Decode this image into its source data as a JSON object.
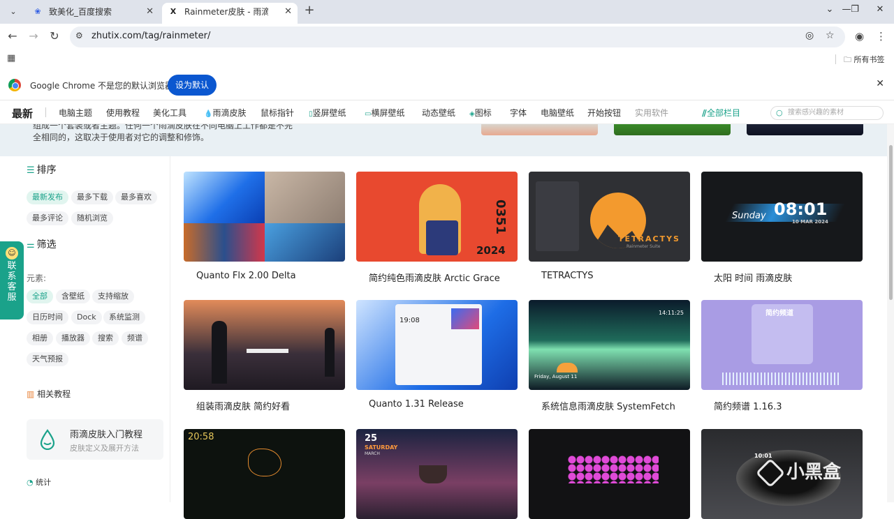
{
  "browser": {
    "tabs": [
      {
        "title": "致美化_百度搜索",
        "favicon": "baidu-paw-icon",
        "active": false
      },
      {
        "title": "Rainmeter皮肤 - 雨滴皮肤 - 致美化",
        "favicon": "zhutix-x-icon",
        "active": true
      }
    ],
    "url": "zhutix.com/tag/rainmeter/",
    "all_bookmarks": "所有书签"
  },
  "infobar": {
    "message": "Google Chrome 不是您的默认浏览器",
    "button": "设为默认"
  },
  "site_nav": {
    "latest": "最新",
    "items": [
      "电脑主题",
      "使用教程",
      "美化工具",
      "雨滴皮肤",
      "鼠标指针",
      "竖屏壁纸",
      "横屏壁纸",
      "动态壁纸",
      "图标",
      "字体",
      "电脑壁纸",
      "开始按钮",
      "实用软件"
    ],
    "all_columns": "全部栏目",
    "search_placeholder": "搜索感兴趣的素材"
  },
  "hero": {
    "text": "组成一个套装或者主题。任何一个雨滴皮肤在不同电脑上工作都是不完全相同的，这取决于使用者对它的调整和修饰。"
  },
  "sidebar": {
    "sort_title": "排序",
    "sort_options": [
      "最新发布",
      "最多下载",
      "最多喜欢",
      "最多评论",
      "随机浏览"
    ],
    "filter_title": "筛选",
    "elements_label": "元素:",
    "element_options": [
      "全部",
      "含壁纸",
      "支持缩放",
      "日历时间",
      "Dock",
      "系统监测",
      "相册",
      "播放器",
      "搜索",
      "频谱",
      "天气预报"
    ],
    "related_title": "相关教程",
    "tutorial_title": "雨滴皮肤入门教程",
    "tutorial_sub": "皮肤定义及展开方法",
    "stats_title": "统计"
  },
  "customer_service": "联系客服",
  "cards": [
    {
      "title": "Quanto Flx 2.00 Delta"
    },
    {
      "title": "简约纯色雨滴皮肤 Arctic Grace",
      "art_text": [
        "0351",
        "2024"
      ]
    },
    {
      "title": "TETRACTYS",
      "art_text": [
        "TETRACTYS",
        "Rainmeter Suite"
      ]
    },
    {
      "title": "太阳 时间 雨滴皮肤",
      "art_text": [
        "Sunday",
        "08:01",
        "10 MAR 2024"
      ]
    },
    {
      "title": "组装雨滴皮肤 简约好看"
    },
    {
      "title": "Quanto 1.31 Release",
      "art_text": [
        "19:08"
      ]
    },
    {
      "title": "系统信息雨滴皮肤 SystemFetch",
      "art_text": [
        "14:11:25",
        "Friday, August 11"
      ]
    },
    {
      "title": "简约频谱 1.16.3",
      "art_text": [
        "简约频道"
      ]
    },
    {
      "title": "",
      "art_text": [
        "20:58"
      ]
    },
    {
      "title": "",
      "art_text": [
        "25",
        "SATURDAY",
        "MARCH"
      ]
    },
    {
      "title": ""
    },
    {
      "title": "",
      "art_text": [
        "10:01"
      ]
    }
  ],
  "watermark": "小黑盒",
  "colors": {
    "accent": "#1aa28a",
    "chrome_blue": "#0b57d0"
  }
}
